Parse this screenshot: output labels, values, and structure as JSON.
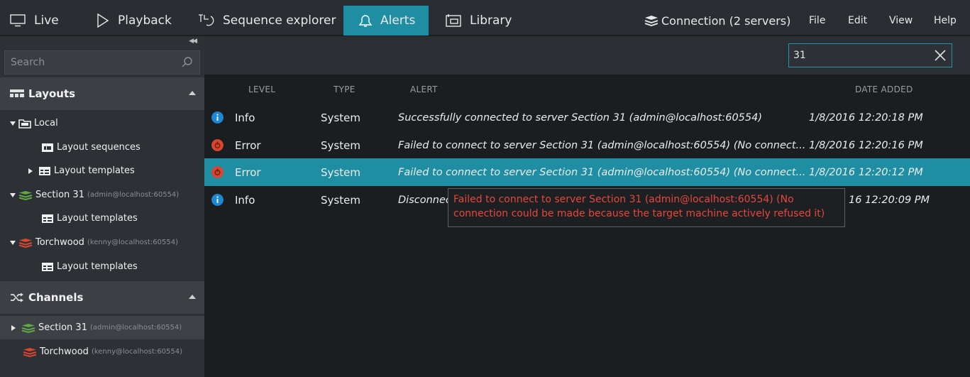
{
  "nav": {
    "tabs": [
      {
        "label": "Live",
        "icon": "monitor-icon"
      },
      {
        "label": "Playback",
        "icon": "play-icon"
      },
      {
        "label": "Sequence explorer",
        "icon": "sequence-icon"
      },
      {
        "label": "Alerts",
        "icon": "bell-icon",
        "active": true
      },
      {
        "label": "Library",
        "icon": "library-icon"
      }
    ],
    "connection_label": "Connection (2 servers)",
    "menu": [
      "File",
      "Edit",
      "View",
      "Help"
    ]
  },
  "sidebar": {
    "search_placeholder": "Search",
    "layouts_title": "Layouts",
    "layouts_tree": [
      {
        "label": "Local",
        "sub": ""
      },
      {
        "label": "Layout sequences",
        "sub": ""
      },
      {
        "label": "Layout templates",
        "sub": ""
      },
      {
        "label": "Section 31",
        "sub": "(admin@localhost:60554)"
      },
      {
        "label": "Layout templates",
        "sub": ""
      },
      {
        "label": "Torchwood",
        "sub": "(kenny@localhost:60554)"
      },
      {
        "label": "Layout templates",
        "sub": ""
      }
    ],
    "channels_title": "Channels",
    "channels_tree": [
      {
        "label": "Section 31",
        "sub": "(admin@localhost:60554)"
      },
      {
        "label": "Torchwood",
        "sub": "(kenny@localhost:60554)"
      }
    ]
  },
  "main": {
    "filter_value": "31",
    "columns": {
      "level": "LEVEL",
      "type": "TYPE",
      "alert": "ALERT",
      "date": "DATE ADDED"
    },
    "rows": [
      {
        "level": "Info",
        "type": "System",
        "alert": "Successfully connected to server Section 31 (admin@localhost:60554)",
        "date": "1/8/2016 12:20:18 PM"
      },
      {
        "level": "Error",
        "type": "System",
        "alert": "Failed to connect to server Section 31 (admin@localhost:60554) (No connect...",
        "date": "1/8/2016 12:20:16 PM"
      },
      {
        "level": "Error",
        "type": "System",
        "alert": "Failed to connect to server Section 31 (admin@localhost:60554) (No connect...",
        "date": "1/8/2016 12:20:12 PM"
      },
      {
        "level": "Info",
        "type": "System",
        "alert": "Disconnec",
        "date": "16 12:20:09 PM"
      }
    ],
    "tooltip": "Failed to connect to server Section 31 (admin@localhost:60554) (No connection could be made because the target machine actively refused it)"
  },
  "colors": {
    "accent": "#1f8ea3",
    "info": "#1e88d4",
    "error": "#d9462f",
    "section31": "#5fa845",
    "torchwood": "#d9462f"
  }
}
